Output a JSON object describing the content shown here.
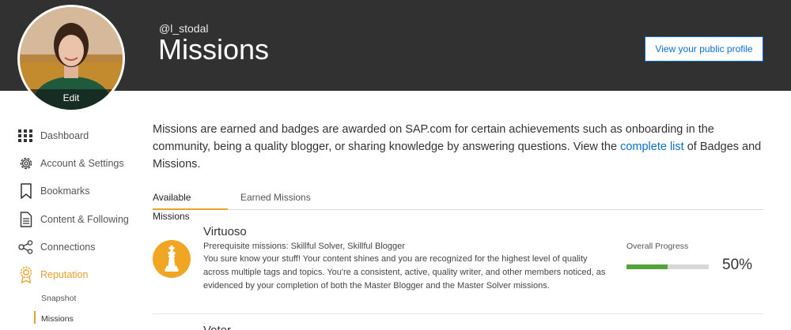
{
  "header": {
    "username": "@l_stodal",
    "title": "Missions",
    "avatar_edit_label": "Edit",
    "public_profile_button": "View your public profile"
  },
  "sidebar": {
    "items": [
      {
        "label": "Dashboard",
        "icon": "grid-icon"
      },
      {
        "label": "Account & Settings",
        "icon": "gear-icon"
      },
      {
        "label": "Bookmarks",
        "icon": "bookmark-icon"
      },
      {
        "label": "Content & Following",
        "icon": "document-icon"
      },
      {
        "label": "Connections",
        "icon": "network-icon"
      },
      {
        "label": "Reputation",
        "icon": "award-icon",
        "active": true
      }
    ],
    "subitems": [
      {
        "label": "Snapshot"
      },
      {
        "label": "Missions",
        "active": true
      }
    ]
  },
  "intro": {
    "text_before": "Missions are earned and badges are awarded on SAP.com for certain achievements such as onboarding in the community, being a quality blogger, or sharing knowledge by answering questions. View the ",
    "link_text": "complete list",
    "text_after": " of Badges and Missions."
  },
  "tabs": [
    {
      "label": "Available Missions",
      "active": true
    },
    {
      "label": "Earned Missions",
      "active": false
    }
  ],
  "missions": [
    {
      "title": "Virtuoso",
      "prerequisites": "Prerequisite missions: Skillful Solver, Skillful Blogger",
      "description": "You sure know your stuff! Your content shines and you are recognized for the highest level of quality across multiple tags and topics. You're a consistent, active, quality writer, and other members noticed, as evidenced by your completion of both the Master Blogger and the Master Solver missions.",
      "progress_label": "Overall Progress",
      "progress_value": "50%",
      "progress_fraction": 0.5,
      "icon": "chess-king-icon"
    },
    {
      "title": "Voter"
    }
  ],
  "colors": {
    "header_bg": "#313131",
    "accent": "#e9a02a",
    "link": "#0a6ed1",
    "progress": "#54a33a"
  }
}
